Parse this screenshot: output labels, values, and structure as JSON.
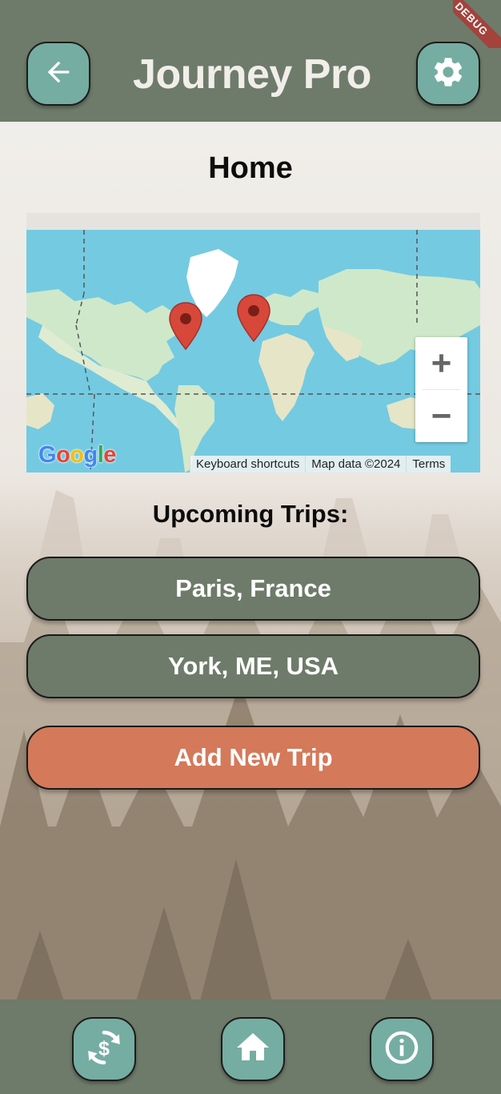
{
  "app": {
    "title": "Journey Pro",
    "debug_label": "DEBUG"
  },
  "page": {
    "title": "Home"
  },
  "map": {
    "zoom_in_label": "+",
    "zoom_out_label": "−",
    "logo_text": "Google",
    "attribution": {
      "shortcuts": "Keyboard shortcuts",
      "data": "Map data ©2024",
      "terms": "Terms"
    },
    "markers": [
      "marker-york",
      "marker-paris"
    ]
  },
  "trips": {
    "heading": "Upcoming Trips:",
    "items": [
      {
        "label": "Paris, France"
      },
      {
        "label": "York, ME, USA"
      }
    ],
    "add_label": "Add New Trip"
  },
  "icons": {
    "back": "arrow-left-icon",
    "settings": "gear-icon",
    "currency": "currency-exchange-icon",
    "home": "home-icon",
    "info": "info-icon"
  },
  "colors": {
    "appbar": "#6f7b6a",
    "icon_button": "#75ada3",
    "trip_button": "#6f7b6a",
    "add_button": "#d47a5b",
    "debug_banner": "#a3433c"
  }
}
